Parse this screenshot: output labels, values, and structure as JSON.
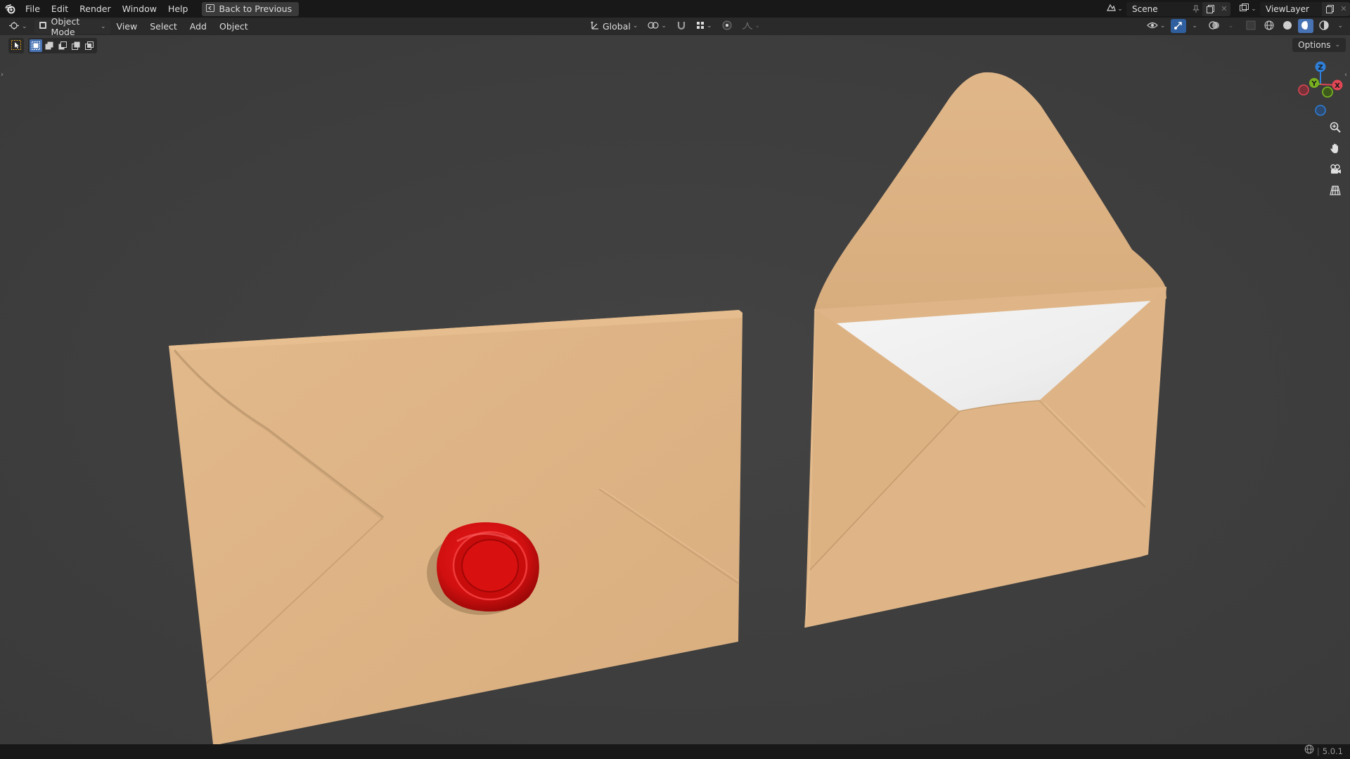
{
  "topbar": {
    "logo": "blender-logo-icon",
    "menus": [
      "File",
      "Edit",
      "Render",
      "Window",
      "Help"
    ],
    "back_button": "Back to Previous",
    "scene_name": "Scene",
    "view_layer_name": "ViewLayer"
  },
  "viewport_header": {
    "mode": "Object Mode",
    "menus": [
      "View",
      "Select",
      "Add",
      "Object"
    ],
    "transform_orientation": "Global"
  },
  "options_label": "Options",
  "gizmo_axes": {
    "x": "X",
    "y": "Y",
    "z": "Z"
  },
  "status": {
    "version": "5.0.1"
  },
  "colors": {
    "viewport_bg": "#3d3d3d",
    "envelope": "#deb486",
    "wax_seal": "#d71414",
    "letter_paper": "#f2f2f2",
    "axis_x": "#e04654",
    "axis_y": "#78b020",
    "axis_z": "#2f7fd8"
  }
}
